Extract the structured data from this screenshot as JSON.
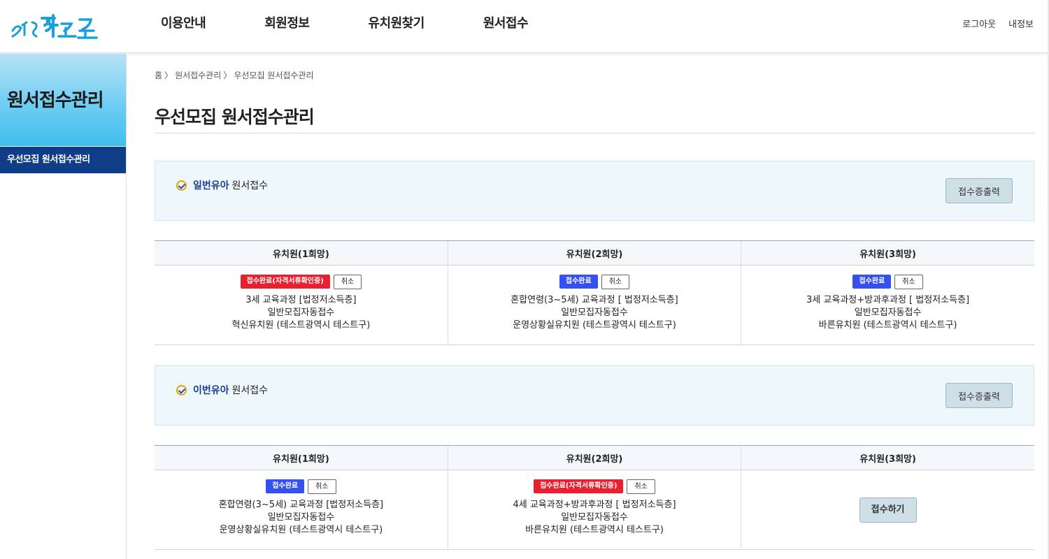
{
  "brand": {
    "logo_text": "처음학교로"
  },
  "header": {
    "nav": [
      "이용안내",
      "회원정보",
      "유치원찾기",
      "원서접수"
    ],
    "util": {
      "logout": "로그아웃",
      "myinfo": "내정보"
    }
  },
  "sidebar": {
    "title": "원서접수관리",
    "menu": [
      "우선모집 원서접수관리"
    ]
  },
  "breadcrumb": [
    "홈",
    "원서접수관리",
    "우선모집 원서접수관리"
  ],
  "breadcrumb_sep": "〉",
  "page_title": "우선모집 원서접수관리",
  "sections": [
    {
      "child_label": "일번유아",
      "suffix": "원서접수",
      "print_button": "접수증출력",
      "columns": [
        "유치원(1희망)",
        "유치원(2희망)",
        "유치원(3희망)"
      ],
      "cells": [
        {
          "status": "접수완료(자격서류확인중)",
          "status_color": "red",
          "cancel": "취소",
          "course": "3세 교육과정 [법정저소득층]",
          "type": "일반모집자동접수",
          "school": "혁신유치원 (테스트광역시 테스트구)"
        },
        {
          "status": "접수완료",
          "status_color": "blue",
          "cancel": "취소",
          "course": "혼합연령(3~5세) 교육과정 [ 법정저소득층]",
          "type": "일반모집자동접수",
          "school": "운영상황실유치원 (테스트광역시 테스트구)"
        },
        {
          "status": "접수완료",
          "status_color": "blue",
          "cancel": "취소",
          "course": "3세 교육과정+방과후과정 [ 법정저소득층]",
          "type": "일반모집자동접수",
          "school": "바른유치원 (테스트광역시 테스트구)"
        }
      ]
    },
    {
      "child_label": "이번유아",
      "suffix": "원서접수",
      "print_button": "접수증출력",
      "columns": [
        "유치원(1희망)",
        "유치원(2희망)",
        "유치원(3희망)"
      ],
      "cells": [
        {
          "status": "접수완료",
          "status_color": "blue",
          "cancel": "취소",
          "course": "혼합연령(3~5세) 교육과정 [법정저소득층]",
          "type": "일반모집자동접수",
          "school": "운영상황실유치원 (테스트광역시 테스트구)"
        },
        {
          "status": "접수완료(자격서류확인중)",
          "status_color": "red",
          "cancel": "취소",
          "course": "4세 교육과정+방과후과정 [ 법정저소득층]",
          "type": "일반모집자동접수",
          "school": "바른유치원 (테스트광역시 테스트구)"
        },
        {
          "apply_button": "접수하기"
        }
      ]
    }
  ],
  "colors": {
    "status_red": "#e8202f",
    "status_blue": "#3550f0",
    "side_menu_active": "#0f3d87",
    "section_bg": "#eef8fc"
  }
}
